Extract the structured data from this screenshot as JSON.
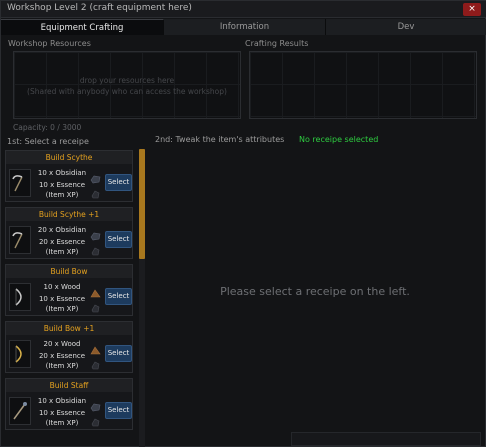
{
  "window": {
    "title": "Workshop Level 2 (craft equipment here)",
    "close_glyph": "×"
  },
  "tabs": [
    {
      "label": "Equipment Crafting",
      "active": true
    },
    {
      "label": "Information",
      "active": false
    },
    {
      "label": "Dev",
      "active": false
    }
  ],
  "resources": {
    "heading": "Workshop Resources",
    "hint_line1": "drop your resources here",
    "hint_line2": "(Shared with anybody who can access the workshop)",
    "capacity": "Capacity: 0 / 3000"
  },
  "results": {
    "heading": "Crafting Results"
  },
  "step1": {
    "label": "1st: Select a receipe"
  },
  "step2": {
    "label": "2nd: Tweak the item's attributes",
    "status": "No receipe selected"
  },
  "placeholder": "Please select a receipe on the left.",
  "colors": {
    "accent": "#e4a11f",
    "ok": "#2ecc40",
    "button": "#1d3b5e",
    "close": "#8e1b1b"
  },
  "recipes": [
    {
      "title": "Build Scythe",
      "material": "10 x Obsidian",
      "essence": "10 x Essence",
      "xp": "(Item XP)",
      "button": "Select",
      "icon": "scythe-icon",
      "material_icon": "obsidian-icon"
    },
    {
      "title": "Build Scythe +1",
      "material": "20 x Obsidian",
      "essence": "20 x Essence",
      "xp": "(Item XP)",
      "button": "Select",
      "icon": "scythe-icon",
      "material_icon": "obsidian-icon"
    },
    {
      "title": "Build Bow",
      "material": "10 x Wood",
      "essence": "10 x Essence",
      "xp": "(Item XP)",
      "button": "Select",
      "icon": "bow-icon",
      "material_icon": "wood-icon"
    },
    {
      "title": "Build Bow +1",
      "material": "20 x Wood",
      "essence": "20 x Essence",
      "xp": "(Item XP)",
      "button": "Select",
      "icon": "bow-icon",
      "material_icon": "wood-icon"
    },
    {
      "title": "Build Staff",
      "material": "10 x Obsidian",
      "essence": "10 x Essence",
      "xp": "(Item XP)",
      "button": "Select",
      "icon": "staff-icon",
      "material_icon": "obsidian-icon"
    }
  ]
}
